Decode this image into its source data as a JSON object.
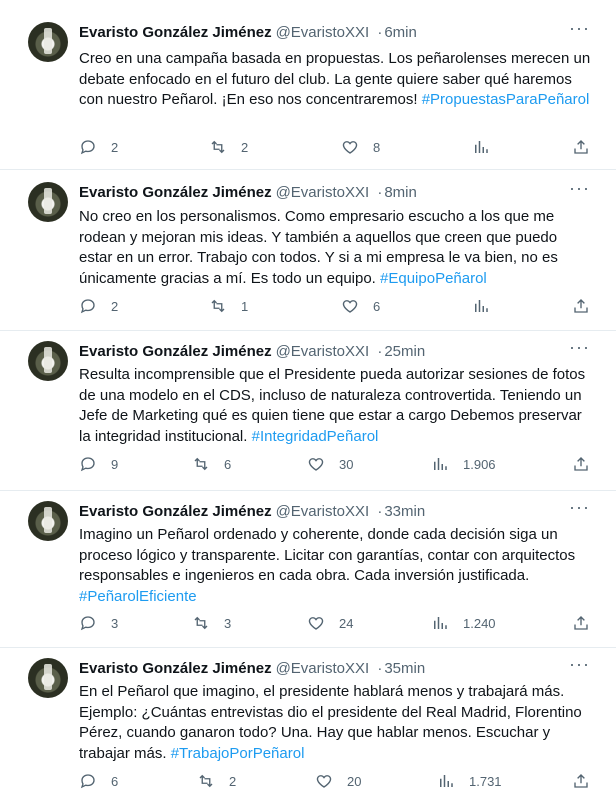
{
  "tweets": [
    {
      "name": "Evaristo González Jiménez",
      "handle": "@EvaristoXXI",
      "time": "6min",
      "text": "Creo en una campaña basada en propuestas. Los peñarolenses merecen un debate enfocado en el futuro del club. La gente quiere saber qué haremos con nuestro Peñarol. ¡En eso nos concentraremos!",
      "hashtag": "#PropuestasParaPeñarol",
      "replies": "2",
      "retweets": "2",
      "likes": "8",
      "views": ""
    },
    {
      "name": "Evaristo González Jiménez",
      "handle": "@EvaristoXXI",
      "time": "8min",
      "text": "No creo en los personalismos. Como empresario escucho a los que me rodean y mejoran mis ideas. Y también a aquellos que creen que puedo estar en un error. Trabajo con todos. Y si a mi empresa le va bien, no es únicamente gracias a mí. Es  todo un equipo.",
      "hashtag": "#EquipoPeñarol",
      "replies": "2",
      "retweets": "1",
      "likes": "6",
      "views": ""
    },
    {
      "name": "Evaristo González Jiménez",
      "handle": "@EvaristoXXI",
      "time": "25min",
      "text": "Resulta incomprensible que el Presidente pueda autorizar sesiones de fotos de una modelo en el CDS, incluso de naturaleza controvertida. Teniendo un Jefe de Marketing qué es quien tiene que estar a cargo Debemos preservar la integridad institucional.",
      "hashtag": "#IntegridadPeñarol",
      "replies": "9",
      "retweets": "6",
      "likes": "30",
      "views": "1.906"
    },
    {
      "name": "Evaristo González Jiménez",
      "handle": "@EvaristoXXI",
      "time": "33min",
      "text": "Imagino un Peñarol ordenado y coherente, donde cada decisión siga un proceso lógico y transparente. Licitar con garantías, contar con arquitectos responsables e ingenieros en cada obra. Cada inversión justificada.",
      "hashtag": "#PeñarolEficiente",
      "replies": "3",
      "retweets": "3",
      "likes": "24",
      "views": "1.240"
    },
    {
      "name": "Evaristo González Jiménez",
      "handle": "@EvaristoXXI",
      "time": "35min",
      "text": "En el Peñarol que imagino, el presidente hablará menos y trabajará más. Ejemplo: ¿Cuántas entrevistas dio el presidente del Real Madrid, Florentino Pérez, cuando ganaron todo? Una. Hay que hablar menos. Escuchar y trabajar más.",
      "hashtag": "#TrabajoPorPeñarol",
      "replies": "6",
      "retweets": "2",
      "likes": "20",
      "views": "1.731"
    }
  ],
  "ui": {
    "separator": "·",
    "more_glyph": "···"
  }
}
